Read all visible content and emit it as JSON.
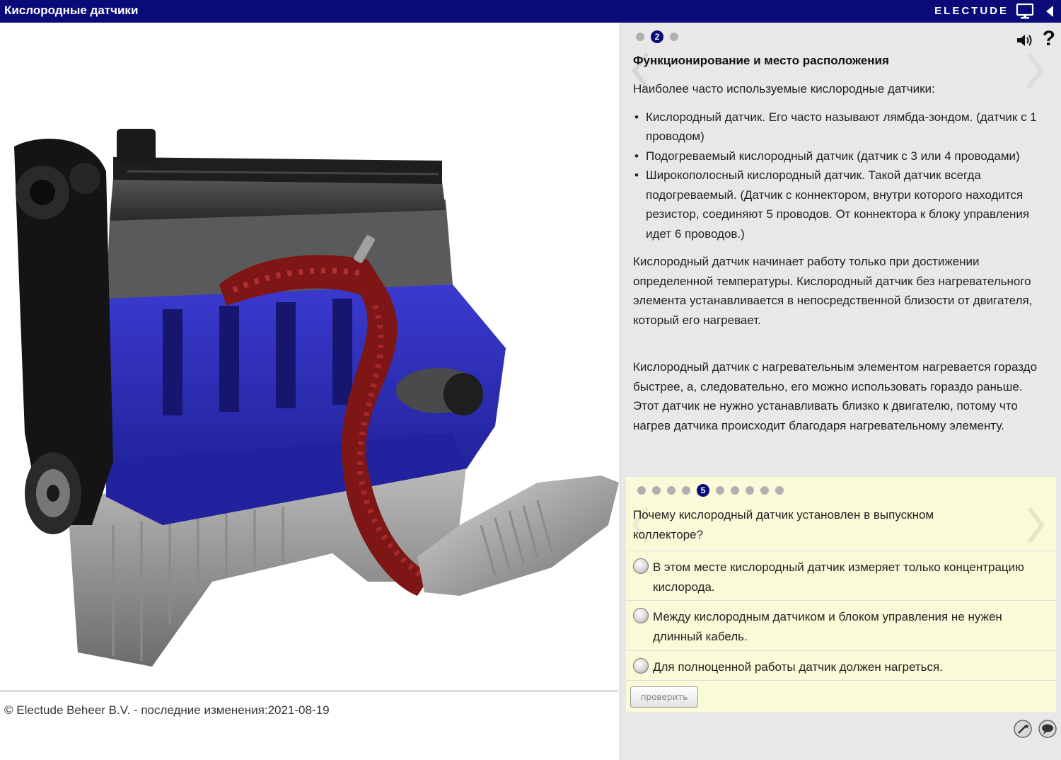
{
  "header": {
    "title": "Кислородные датчики",
    "brand": "ELECTUDE"
  },
  "footer": {
    "copyright": "© Electude Beheer B.V. - последние изменения:2021-08-19"
  },
  "info_panel": {
    "page_dots": {
      "count": 3,
      "active_index": 1,
      "active_label": "2"
    },
    "section_title": "Функционирование и место расположения",
    "intro": "Наиболее часто используемые кислородные датчики:",
    "bullets": [
      "Кислородный датчик. Его часто называют лямбда-зондом. (датчик с 1 проводом)",
      "Подогреваемый кислородный датчик (датчик с 3 или 4 проводами)",
      "Широкополосный кислородный датчик. Такой датчик всегда подогреваемый. (Датчик с коннектором, внутри которого находится резистор, соединяют 5 проводов. От коннектора к блоку управления идет 6 проводов.)"
    ],
    "paragraph1": "Кислородный датчик начинает работу только при достижении определенной температуры. Кислородный датчик без нагревательного элемента устанавливается в непосредственной близости от двигателя, который его нагревает.",
    "paragraph2": "Кислородный датчик с нагревательным элементом нагревается гораздо быстрее, а, следовательно, его можно использовать гораздо раньше. Этот датчик не нужно устанавливать близко к двигателю, потому что нагрев датчика происходит благодаря нагревательному элементу."
  },
  "quiz": {
    "dots": {
      "count": 10,
      "active_index": 4,
      "active_label": "5"
    },
    "question": "Почему кислородный датчик установлен в выпускном коллекторе?",
    "options": [
      "В этом месте кислородный датчик измеряет только концентрацию кислорода.",
      "Между кислородным датчиком и блоком управления не нужен длинный кабель.",
      "Для полноценной работы датчик должен нагреться."
    ],
    "check_label": "проверить"
  },
  "icons": {
    "monitor": "monitor-icon",
    "collapse": "triangle-left-icon",
    "speaker": "speaker-icon",
    "help": "question-mark-icon",
    "next": "chevron-right-icon",
    "prev": "chevron-left-icon",
    "tool1": "magic-wand-icon",
    "tool2": "speech-bubble-icon"
  },
  "colors": {
    "header_bg": "#0a0a78",
    "panel_bg": "#e8e8e8",
    "quiz_bg": "#fafad8",
    "engine_blue": "#2a2ab8",
    "exhaust_red": "#8a1a1a"
  }
}
